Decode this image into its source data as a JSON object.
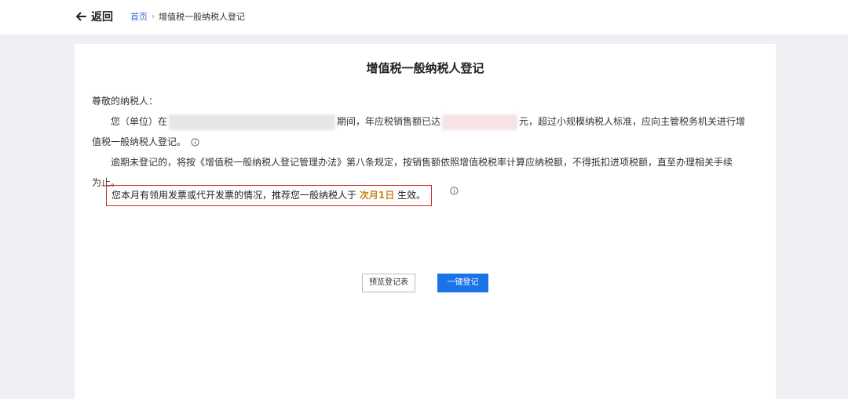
{
  "header": {
    "back_label": "返回",
    "breadcrumb_home": "首页",
    "breadcrumb_sep": "›",
    "breadcrumb_current": "增值税一般纳税人登记"
  },
  "notice": {
    "title": "增值税一般纳税人登记",
    "greeting": "尊敬的纳税人：",
    "p1_start": "您（单位）在",
    "p1_mid": "期间，年应税销售额已达",
    "p1_end": "元，超过小规模纳税人标准，应向主管税务机关进行增",
    "p1_cont": "值税一般纳税人登记。",
    "p2_line1": "逾期未登记的，将按《增值税一般纳税人登记管理办法》第八条规定，按销售额依照增值税税率计算应纳税额，不得抵扣进项税额，直至办理相关手续",
    "p2_line2": "为止。",
    "highlight_prefix": "您本月有领用发票或代开发票的情况，推荐您一般纳税人于",
    "highlight_date": "次月1日",
    "highlight_suffix": "生效。"
  },
  "actions": {
    "preview_label": "预览登记表",
    "register_label": "一键登记"
  },
  "colors": {
    "link": "#2f6ed9",
    "primary": "#1a73e8",
    "highlight_border": "#d22b2b",
    "date_accent": "#c9861c"
  },
  "icons": {
    "back": "arrow-left-icon",
    "info": "info-circle-icon"
  }
}
